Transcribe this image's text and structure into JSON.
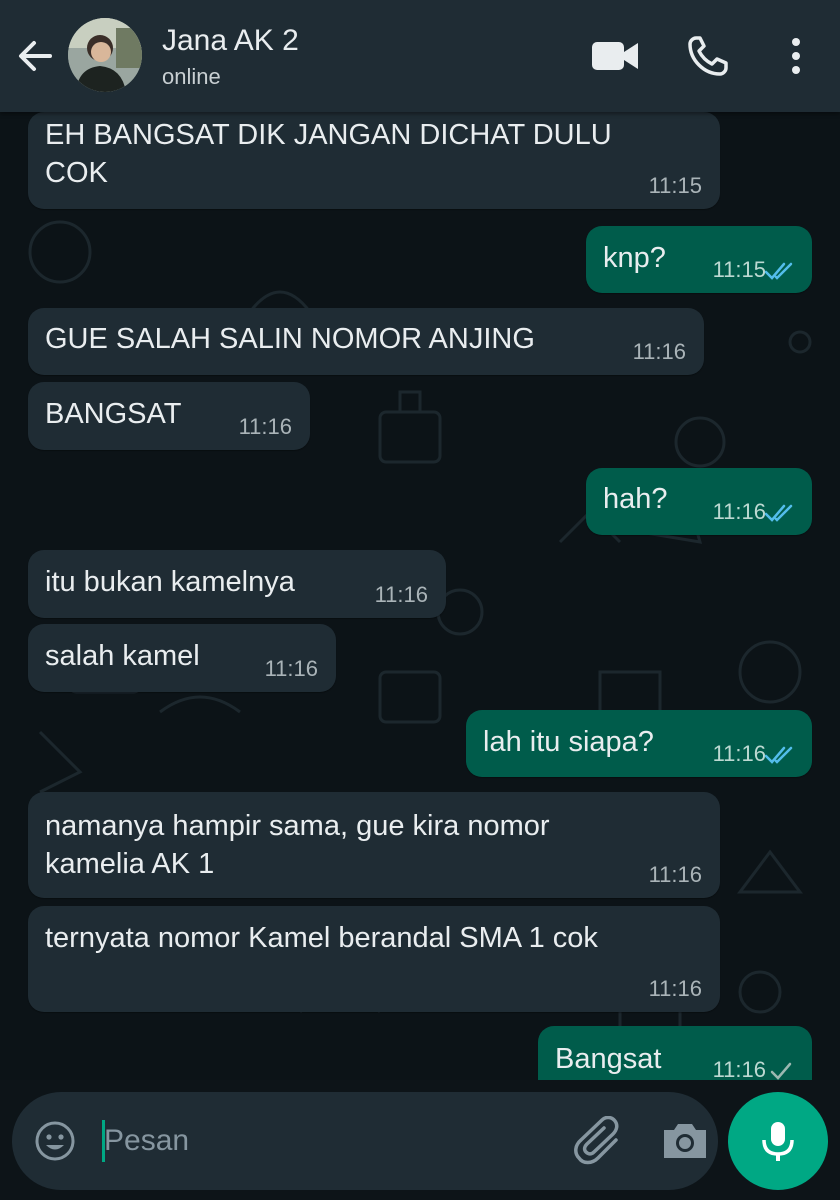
{
  "header": {
    "contact_name": "Jana AK 2",
    "status": "online",
    "icons": [
      "back-arrow-icon",
      "avatar",
      "video-call-icon",
      "phone-icon",
      "more-options-icon"
    ]
  },
  "colors": {
    "header_bg": "#1f2c34",
    "incoming_bubble": "#1f2c34",
    "outgoing_bubble": "#005c4b",
    "chat_bg": "#0c1317",
    "accent": "#00a884",
    "read_tick": "#53bdeb"
  },
  "messages": [
    {
      "dir": "in",
      "text": "EH BANGSAT DIK JANGAN DICHAT DULU\nCOK",
      "time": "11:15"
    },
    {
      "dir": "out",
      "text": "knp?",
      "time": "11:15",
      "status": "read"
    },
    {
      "dir": "in",
      "text": "GUE SALAH SALIN NOMOR ANJING",
      "time": "11:16"
    },
    {
      "dir": "in",
      "text": "BANGSAT",
      "time": "11:16"
    },
    {
      "dir": "out",
      "text": "hah?",
      "time": "11:16",
      "status": "read"
    },
    {
      "dir": "in",
      "text": "itu bukan kamelnya",
      "time": "11:16"
    },
    {
      "dir": "in",
      "text": "salah kamel",
      "time": "11:16"
    },
    {
      "dir": "out",
      "text": "lah itu siapa?",
      "time": "11:16",
      "status": "read"
    },
    {
      "dir": "in",
      "text": "namanya hampir sama, gue kira nomor\nkamelia AK 1",
      "time": "11:16"
    },
    {
      "dir": "in",
      "text": "ternyata nomor Kamel berandal SMA 1 cok",
      "time": "11:16"
    },
    {
      "dir": "out",
      "text": "Bangsat",
      "time": "11:16",
      "status": "sent"
    }
  ],
  "composer": {
    "placeholder": "Pesan",
    "value": "",
    "icons": [
      "emoji-icon",
      "attach-icon",
      "camera-icon",
      "mic-icon"
    ]
  }
}
